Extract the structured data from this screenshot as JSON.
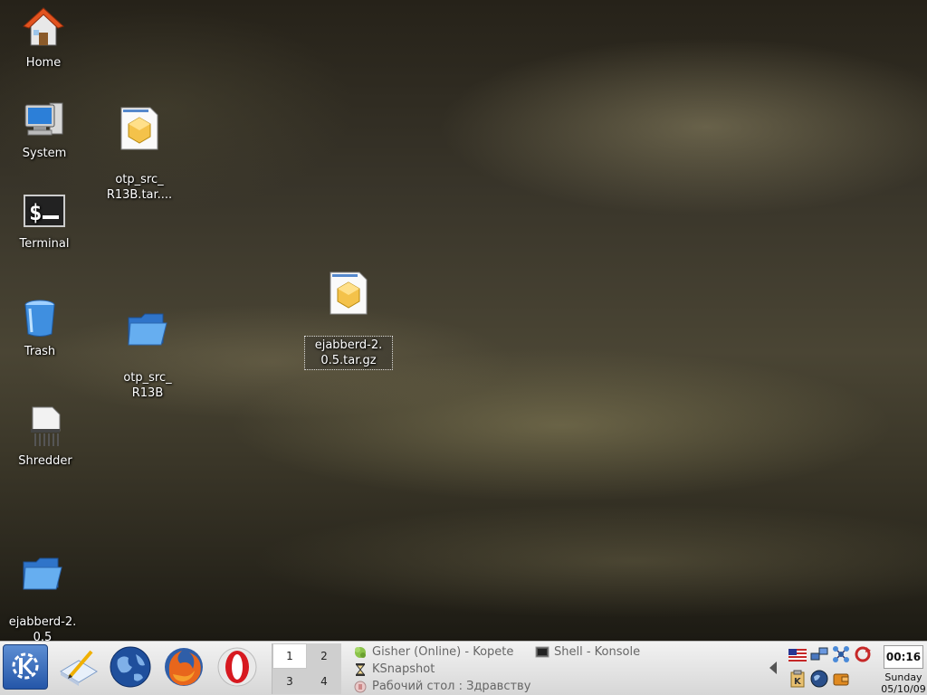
{
  "desktop": {
    "icons": [
      {
        "id": "home",
        "label": "Home",
        "icon": "home-folder-icon"
      },
      {
        "id": "system",
        "label": "System",
        "icon": "computer-icon"
      },
      {
        "id": "terminal",
        "label": "Terminal",
        "icon": "terminal-icon"
      },
      {
        "id": "trash",
        "label": "Trash",
        "icon": "trash-icon"
      },
      {
        "id": "shredder",
        "label": "Shredder",
        "icon": "shredder-icon"
      },
      {
        "id": "ejabberd-folder",
        "label": "ejabberd-2.\n0.5",
        "icon": "folder-icon"
      },
      {
        "id": "otp-archive",
        "label": "otp_src_\nR13B.tar....",
        "icon": "archive-file-icon"
      },
      {
        "id": "otp-folder",
        "label": "otp_src_\nR13B",
        "icon": "folder-icon"
      },
      {
        "id": "ejabberd-archive",
        "label": "ejabberd-2.\n0.5.tar.gz",
        "icon": "archive-file-icon",
        "selected": true
      }
    ]
  },
  "panel": {
    "kmenu": {
      "icon": "kde-k-menu-icon"
    },
    "launchers": [
      {
        "name": "text-editor",
        "icon": "text-editor-icon"
      },
      {
        "name": "konqueror",
        "icon": "globe-browser-icon"
      },
      {
        "name": "firefox",
        "icon": "firefox-icon"
      },
      {
        "name": "opera",
        "icon": "opera-icon"
      }
    ],
    "pager": {
      "desktops": [
        "1",
        "2",
        "3",
        "4"
      ],
      "active": "1"
    },
    "tasks": [
      {
        "label": "Gisher (Online) - Kopete",
        "icon": "kopete-icon"
      },
      {
        "label": "Shell - Konsole",
        "icon": "konsole-icon"
      },
      {
        "label": "KSnapshot",
        "icon": "hourglass-icon"
      },
      {
        "label": "Рабочий стол : Здравству",
        "icon": "desktop-icon"
      }
    ],
    "tray": [
      {
        "name": "keyboard-layout",
        "icon": "us-flag-icon"
      },
      {
        "name": "network",
        "icon": "network-icon"
      },
      {
        "name": "network-manager",
        "icon": "network-manager-icon"
      },
      {
        "name": "updater",
        "icon": "update-icon"
      },
      {
        "name": "klipper",
        "icon": "klipper-icon"
      },
      {
        "name": "browser-tray",
        "icon": "globe-icon"
      },
      {
        "name": "wallet",
        "icon": "wallet-icon"
      }
    ],
    "clock": {
      "time": "00:16",
      "day": "Sunday",
      "date": "05/10/09"
    }
  },
  "colors": {
    "panel_bg": "#e2e2e2",
    "kmenu_blue": "#2456a8",
    "desktop_text": "#ffffff"
  }
}
